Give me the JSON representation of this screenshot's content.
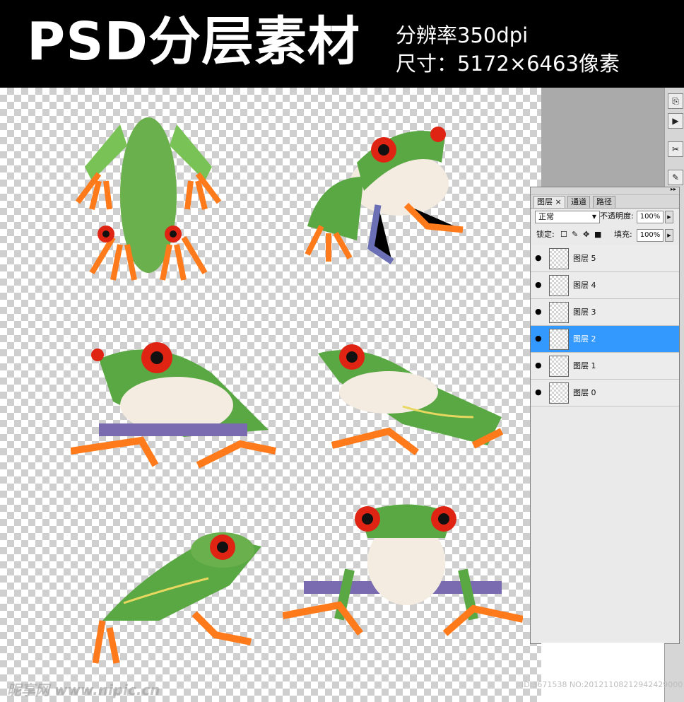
{
  "header": {
    "title": "PSD分层素材",
    "resolution": "分辨率350dpi",
    "size": "尺寸：5172×6463像素"
  },
  "panel": {
    "tabs": [
      "图层",
      "通道",
      "路径"
    ],
    "tab_close": "×",
    "menu_icon": "▸▸",
    "blend_mode": "正常",
    "opacity_label": "不透明度:",
    "opacity_value": "100%",
    "lock_label": "锁定:",
    "fill_label": "填充:",
    "fill_value": "100%",
    "layers": [
      {
        "name": "图层 5",
        "selected": false
      },
      {
        "name": "图层 4",
        "selected": false
      },
      {
        "name": "图层 3",
        "selected": false
      },
      {
        "name": "图层 2",
        "selected": true
      },
      {
        "name": "图层 1",
        "selected": false
      },
      {
        "name": "图层 0",
        "selected": false
      }
    ]
  },
  "toolstrip": [
    "history-icon",
    "play-icon",
    "tools-icon",
    "brush-icon"
  ],
  "watermark": {
    "site": "昵享网 www.nipic.cn",
    "id": "ID:3671538 NO:20121108212942429000"
  },
  "colors": {
    "frog_green": "#6ab04c",
    "frog_orange": "#ff7a1a",
    "frog_eye": "#e02414",
    "selection": "#3399ff"
  }
}
